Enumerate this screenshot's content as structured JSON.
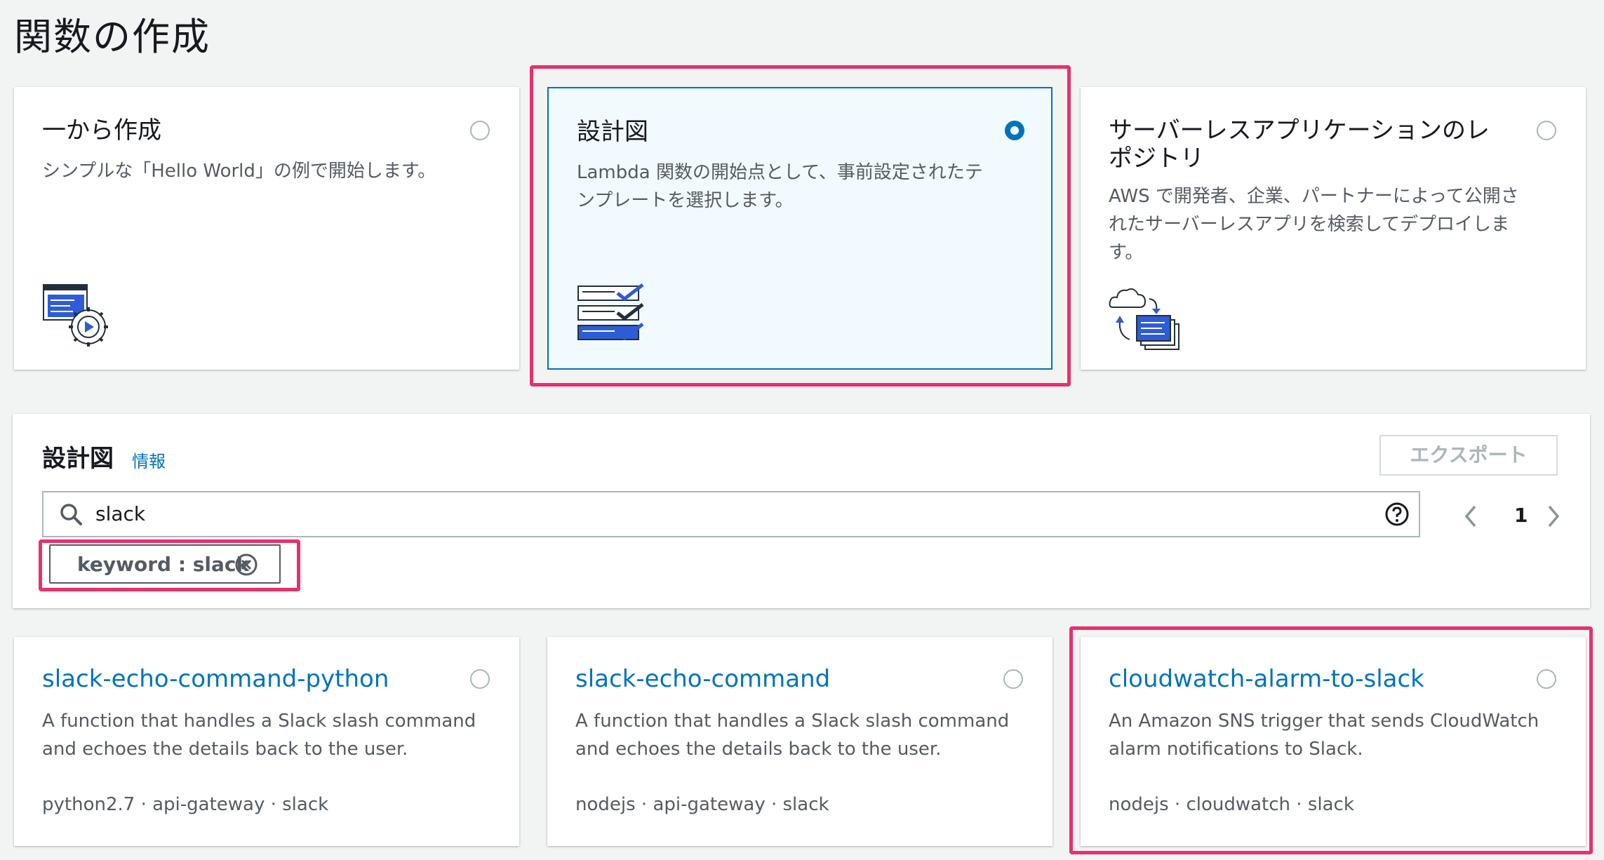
{
  "page": {
    "title": "関数の作成"
  },
  "options": [
    {
      "title": "一から作成",
      "desc_lines": [
        "シンプルな「Hello World」の例で開始します。"
      ],
      "icon": "author-from-scratch-icon",
      "selected": false
    },
    {
      "title": "設計図",
      "desc_lines": [
        "Lambda 関数の開始点として、事前設定されたテ",
        "ンプレートを選択します。"
      ],
      "icon": "blueprints-icon",
      "selected": true
    },
    {
      "title_lines": [
        "サーバーレスアプリケーションのレ",
        "ポジトリ"
      ],
      "desc_lines": [
        "AWS で開発者、企業、パートナーによって公開さ",
        "れたサーバーレスアプリを検索してデプロイしま",
        "す。"
      ],
      "icon": "serverless-app-repo-icon",
      "selected": false
    }
  ],
  "blueprints_panel": {
    "title": "設計図",
    "info_link": "情報",
    "export_label": "エクスポート",
    "search_value": "slack",
    "filter_token": "keyword : slack",
    "current_page": "1"
  },
  "blueprints": [
    {
      "name": "slack-echo-command-python",
      "desc_lines": [
        "A function that handles a Slack slash command",
        "and echoes the details back to the user."
      ],
      "tags": "python2.7 · api-gateway · slack"
    },
    {
      "name": "slack-echo-command",
      "desc_lines": [
        "A function that handles a Slack slash command",
        "and echoes the details back to the user."
      ],
      "tags": "nodejs · api-gateway · slack"
    },
    {
      "name": "cloudwatch-alarm-to-slack",
      "desc_lines": [
        "An Amazon SNS trigger that sends CloudWatch",
        "alarm notifications to Slack."
      ],
      "tags": "nodejs · cloudwatch · slack"
    }
  ],
  "colors": {
    "accent": "#0073bb",
    "highlight": "#e8306a",
    "text": "#16191f",
    "muted": "#545b64"
  }
}
